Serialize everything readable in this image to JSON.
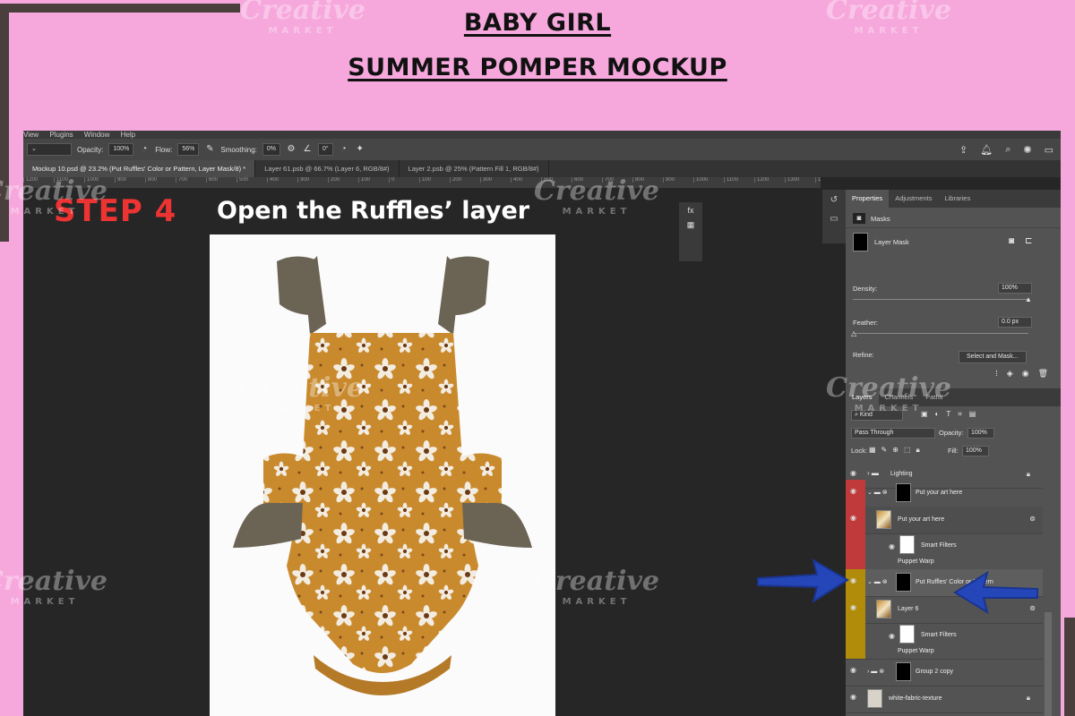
{
  "page_title_line1": "BABY GIRL",
  "page_title_line2": "SUMMER POMPER MOCKUP",
  "menu": [
    "View",
    "Plugins",
    "Window",
    "Help"
  ],
  "options": {
    "opacity_label": "Opacity:",
    "opacity_value": "100%",
    "flow_label": "Flow:",
    "flow_value": "56%",
    "smoothing_label": "Smoothing:",
    "smoothing_value": "0%",
    "angle_value": "0°"
  },
  "tabs": [
    "Mockup 10.psd @ 23.2% (Put Ruffles' Color or Pattern, Layer Mask/8) *",
    "Layer 61.psb @ 66.7% (Layer 6, RGB/8#)",
    "Layer 2.psb @ 25% (Pattern Fill 1, RGB/8#)"
  ],
  "ruler_ticks": [
    "1200",
    "1100",
    "1000",
    "900",
    "800",
    "700",
    "600",
    "500",
    "400",
    "300",
    "200",
    "100",
    "0",
    "100",
    "200",
    "300",
    "400",
    "500",
    "600",
    "700",
    "800",
    "900",
    "1000",
    "1100",
    "1200",
    "1300",
    "1400",
    "1500",
    "1600",
    "1700",
    "1800",
    "1900",
    "2000",
    "2100",
    "2200",
    "2300",
    "2400",
    "2500"
  ],
  "step_label": "STEP 4",
  "instruction": "Open the Ruffles’ layer",
  "properties": {
    "tabs": [
      "Properties",
      "Adjustments",
      "Libraries"
    ],
    "masks_label": "Masks",
    "layer_mask_label": "Layer Mask",
    "density_label": "Density:",
    "density_value": "100%",
    "density_fraction": 1.0,
    "feather_label": "Feather:",
    "feather_value": "0.0 px",
    "refine_label": "Refine:",
    "select_mask_button": "Select and Mask..."
  },
  "layers_panel": {
    "tabs": [
      "Layers",
      "Channels",
      "Paths"
    ],
    "kind_label": "Kind",
    "blend_mode": "Pass Through",
    "opacity_label": "Opacity:",
    "opacity_value": "100%",
    "lock_label": "Lock:",
    "fill_label": "Fill:",
    "fill_value": "100%",
    "layers": [
      {
        "name": "Lighting",
        "color": "",
        "thumb": "folder"
      },
      {
        "name": "Put your art here",
        "color": "#c0393b",
        "thumb": "black"
      },
      {
        "name": "Put your art here",
        "color": "#c0393b",
        "thumb": "art"
      },
      {
        "name": "Smart Filters",
        "color": "#c0393b",
        "thumb": "white"
      },
      {
        "name": "Put Ruffles' Color or Pattern",
        "color": "#b08c0a",
        "thumb": "black"
      },
      {
        "name": "Layer 6",
        "color": "#b08c0a",
        "thumb": "art"
      },
      {
        "name": "Smart Filters",
        "color": "#b08c0a",
        "thumb": "white"
      },
      {
        "name": "Group 2 copy",
        "color": "",
        "thumb": "black"
      },
      {
        "name": "white-fabric-texture",
        "color": "",
        "thumb": "tex"
      }
    ],
    "sublabels": [
      "Puppet Warp",
      "Puppet Warp"
    ]
  },
  "watermark_text": "Creative",
  "watermark_sub": "MARKET",
  "colors": {
    "background": "#f6a8dd",
    "step": "#ee3333",
    "arrow": "#2446b8",
    "fabric": "#c98a2e",
    "ruffle": "#6b6455"
  }
}
